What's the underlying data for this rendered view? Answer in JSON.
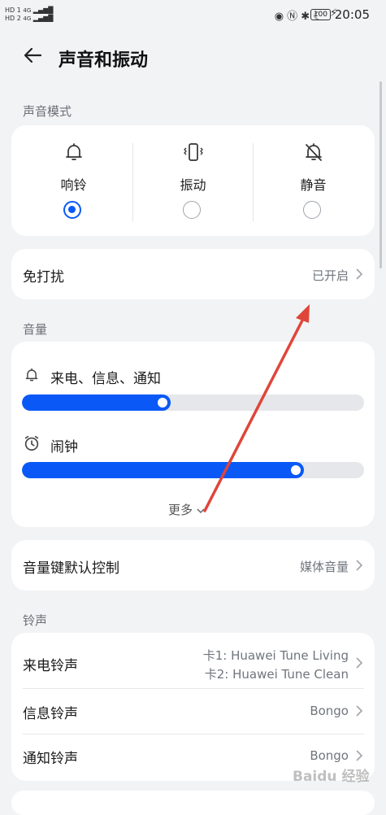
{
  "status_bar": {
    "left_indicators": [
      "HD 1",
      "HD 2"
    ],
    "network": [
      "4G",
      "4G"
    ],
    "battery": "100",
    "time": "20:05"
  },
  "header": {
    "title": "声音和振动"
  },
  "sound_mode": {
    "section_label": "声音模式",
    "options": [
      {
        "label": "响铃",
        "icon": "bell-icon",
        "selected": true
      },
      {
        "label": "振动",
        "icon": "vibrate-icon",
        "selected": false
      },
      {
        "label": "静音",
        "icon": "bell-mute-icon",
        "selected": false
      }
    ]
  },
  "dnd": {
    "label": "免打扰",
    "value": "已开启"
  },
  "volume": {
    "section_label": "音量",
    "sliders": [
      {
        "label": "来电、信息、通知",
        "icon": "bell-icon",
        "level": 0.41
      },
      {
        "label": "闹钟",
        "icon": "alarm-clock-icon",
        "level": 0.8
      }
    ],
    "more_label": "更多"
  },
  "volume_key": {
    "label": "音量键默认控制",
    "value": "媒体音量"
  },
  "ringtones": {
    "section_label": "铃声",
    "items": [
      {
        "label": "来电铃声",
        "value_line1": "卡1: Huawei Tune Living",
        "value_line2": "卡2: Huawei Tune Clean"
      },
      {
        "label": "信息铃声",
        "value": "Bongo"
      },
      {
        "label": "通知铃声",
        "value": "Bongo"
      }
    ]
  },
  "watermark": "Baidu 经验",
  "colors": {
    "accent": "#0a59f7",
    "annotation_arrow": "#e0453a"
  }
}
